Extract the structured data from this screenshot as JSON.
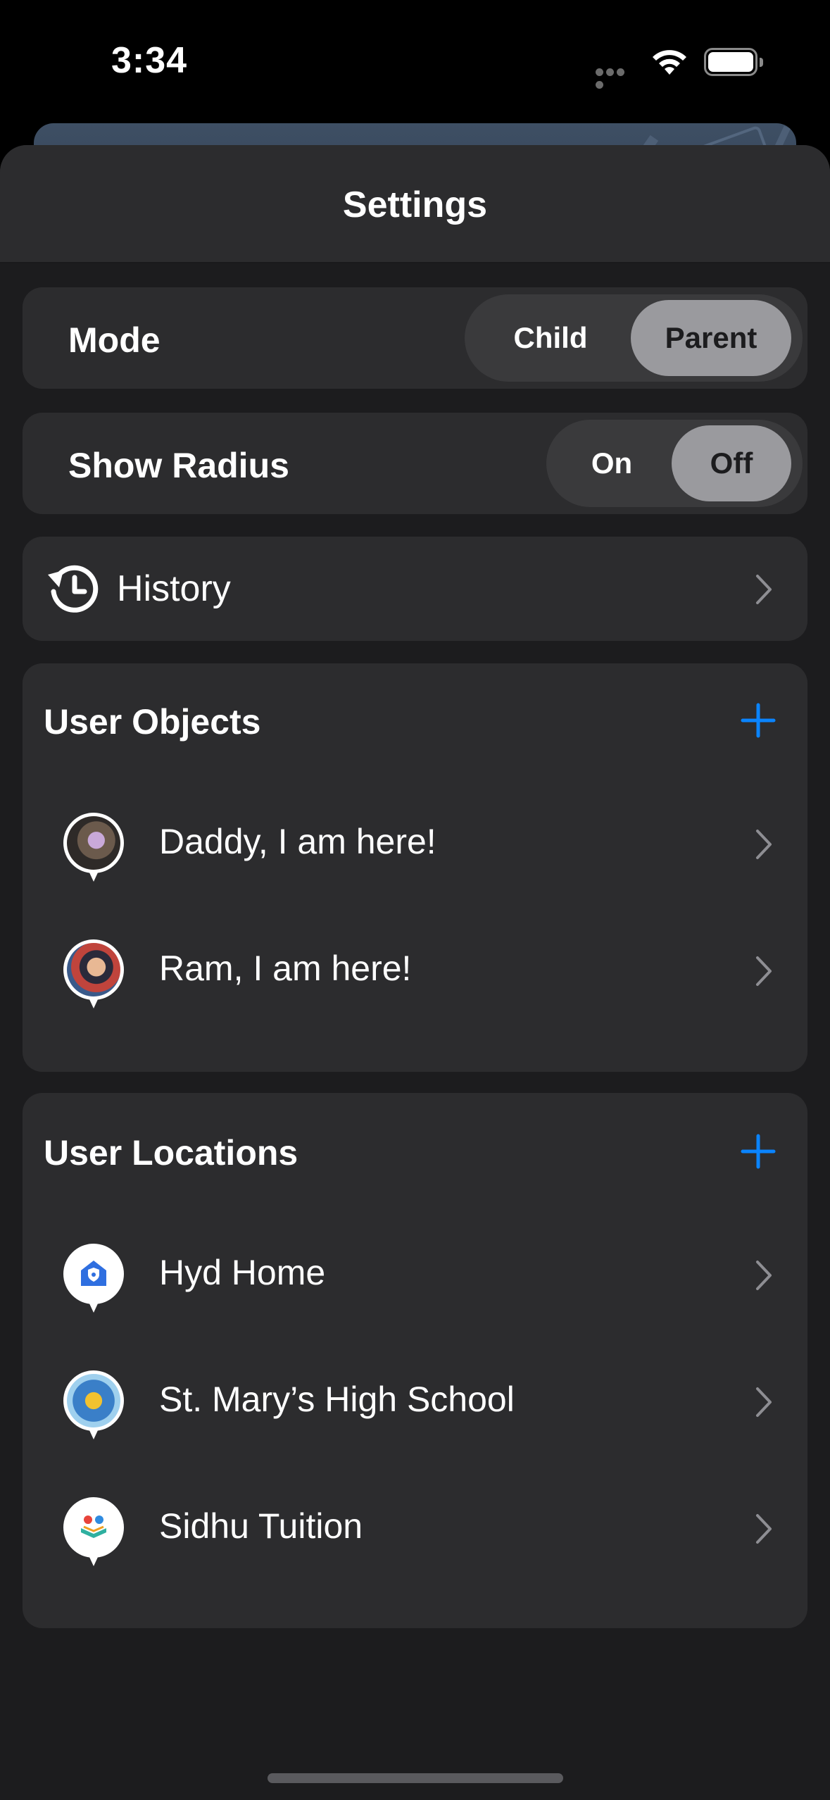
{
  "status_bar": {
    "time": "3:34",
    "icons": [
      "signal-dots-icon",
      "wifi-icon",
      "battery-icon"
    ]
  },
  "sheet": {
    "title": "Settings"
  },
  "mode": {
    "label": "Mode",
    "options": [
      "Child",
      "Parent"
    ],
    "selected": "Parent"
  },
  "show_radius": {
    "label": "Show Radius",
    "options": [
      "On",
      "Off"
    ],
    "selected": "Off"
  },
  "history": {
    "label": "History",
    "icon": "history-icon"
  },
  "user_objects": {
    "title": "User Objects",
    "items": [
      {
        "label": "Daddy, I am here!",
        "icon": "avatar-pin-icon"
      },
      {
        "label": "Ram, I am here!",
        "icon": "avatar-pin-icon"
      }
    ]
  },
  "user_locations": {
    "title": "User Locations",
    "items": [
      {
        "label": "Hyd Home",
        "icon": "home-pin-icon"
      },
      {
        "label": "St. Mary’s High School",
        "icon": "school-pin-icon"
      },
      {
        "label": "Sidhu Tuition",
        "icon": "tuition-pin-icon"
      }
    ]
  },
  "colors": {
    "accent": "#0a84ff",
    "sheet_bg": "#1c1c1e",
    "card_bg": "#2c2c2e",
    "segment_active": "#9a9a9e"
  }
}
